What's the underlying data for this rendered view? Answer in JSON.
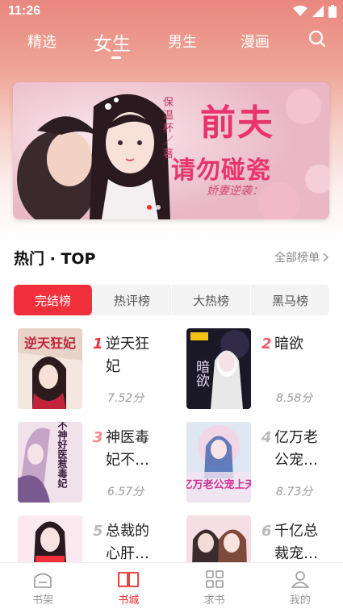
{
  "status_bar": {
    "time": "11:26",
    "icons": [
      "wifi-icon",
      "signal-icon",
      "battery-icon"
    ]
  },
  "top_nav": {
    "tabs": [
      {
        "label": "精选",
        "active": false
      },
      {
        "label": "女生",
        "active": true
      },
      {
        "label": "男生",
        "active": false
      },
      {
        "label": "漫画",
        "active": false
      }
    ],
    "search_icon": "search-icon"
  },
  "banner": {
    "title_line1": "前夫",
    "title_line2": "请勿碰瓷",
    "subtitle": "娇妻逆袭：",
    "author": "保温杯／著",
    "slide_count": 2,
    "active_slide": 0
  },
  "section": {
    "title": "热门 · TOP",
    "more_label": "全部榜单"
  },
  "rank_tabs": [
    {
      "label": "完结榜",
      "active": true
    },
    {
      "label": "热评榜",
      "active": false
    },
    {
      "label": "大热榜",
      "active": false
    },
    {
      "label": "黑马榜",
      "active": false
    }
  ],
  "books": [
    {
      "rank": "1",
      "name": "逆天狂妃",
      "score": "7.52分",
      "cover_text": "逆天狂妃",
      "rank_color": "#f1303c"
    },
    {
      "rank": "2",
      "name": "暗欲",
      "score": "8.58分",
      "cover_text": "暗欲",
      "rank_color": "#f4586a"
    },
    {
      "rank": "3",
      "name": "神医毒妃不…",
      "score": "6.57分",
      "cover_text": "不神好医惹毒妃",
      "rank_color": "#f5878f"
    },
    {
      "rank": "4",
      "name": "亿万老公宠…",
      "score": "8.73分",
      "cover_text": "亿万老公宠上天",
      "rank_color": "#bbbbbb"
    },
    {
      "rank": "5",
      "name": "总裁的心肝…",
      "score": "",
      "cover_text": "",
      "rank_color": "#bbbbbb"
    },
    {
      "rank": "6",
      "name": "千亿总裁宠…",
      "score": "",
      "cover_text": "",
      "rank_color": "#bbbbbb"
    }
  ],
  "bottom_nav": [
    {
      "label": "书架",
      "icon": "bookshelf-icon",
      "active": false
    },
    {
      "label": "书城",
      "icon": "book-open-icon",
      "active": true
    },
    {
      "label": "求书",
      "icon": "grid-icon",
      "active": false
    },
    {
      "label": "我的",
      "icon": "user-icon",
      "active": false
    }
  ],
  "colors": {
    "accent": "#e5322e",
    "rank_tab_active": "#f1303c",
    "banner_title": "#e8336b"
  }
}
